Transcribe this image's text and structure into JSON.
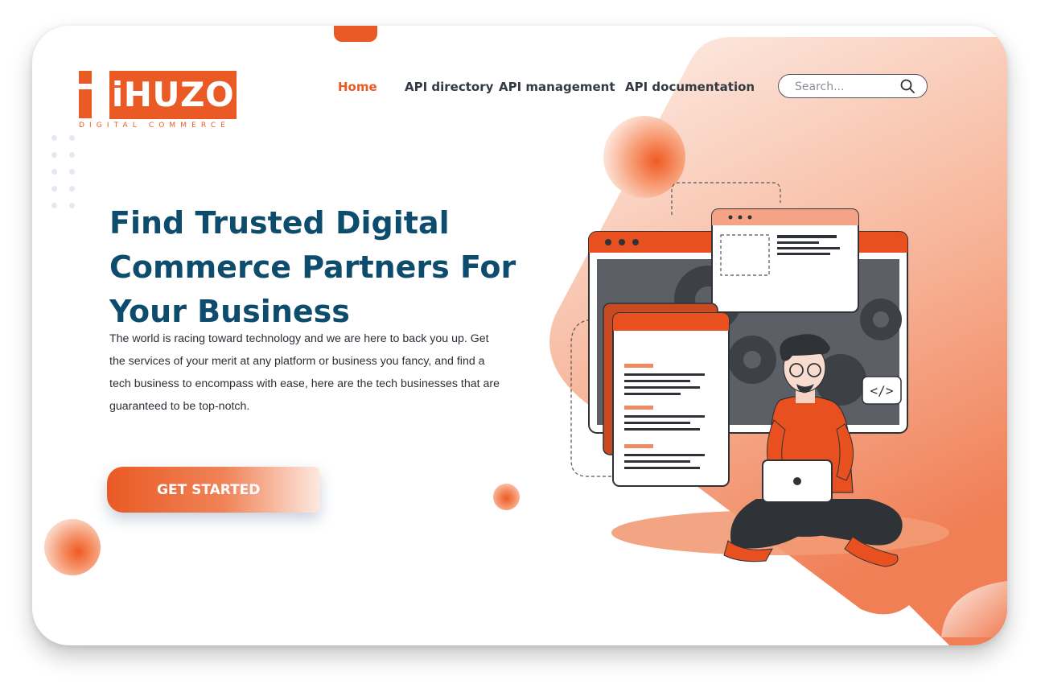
{
  "brand": {
    "name": "iHUZO",
    "tagline": "DIGITAL COMMERCE",
    "accent": "#e95a24",
    "title_color": "#0d4c6c"
  },
  "nav": {
    "items": [
      {
        "label": "Home",
        "active": true
      },
      {
        "label": "API directory",
        "active": false
      },
      {
        "label": "API  management",
        "active": false
      },
      {
        "label": "API documentation",
        "active": false
      }
    ]
  },
  "search": {
    "placeholder": "Search...",
    "icon": "search-icon"
  },
  "hero": {
    "title_lines": [
      "Find Trusted Digital",
      "Commerce Partners For",
      "Your Business"
    ],
    "description": "The world is racing toward technology and we are here to back you up. Get the services of your merit at any platform or business you fancy, and find a tech business to encompass with ease, here are the tech businesses that are guaranteed to be top-notch.",
    "cta_label": "GET STARTED"
  },
  "illustration": {
    "code_tag": "</>",
    "icon": "developer-with-laptop-illustration"
  }
}
